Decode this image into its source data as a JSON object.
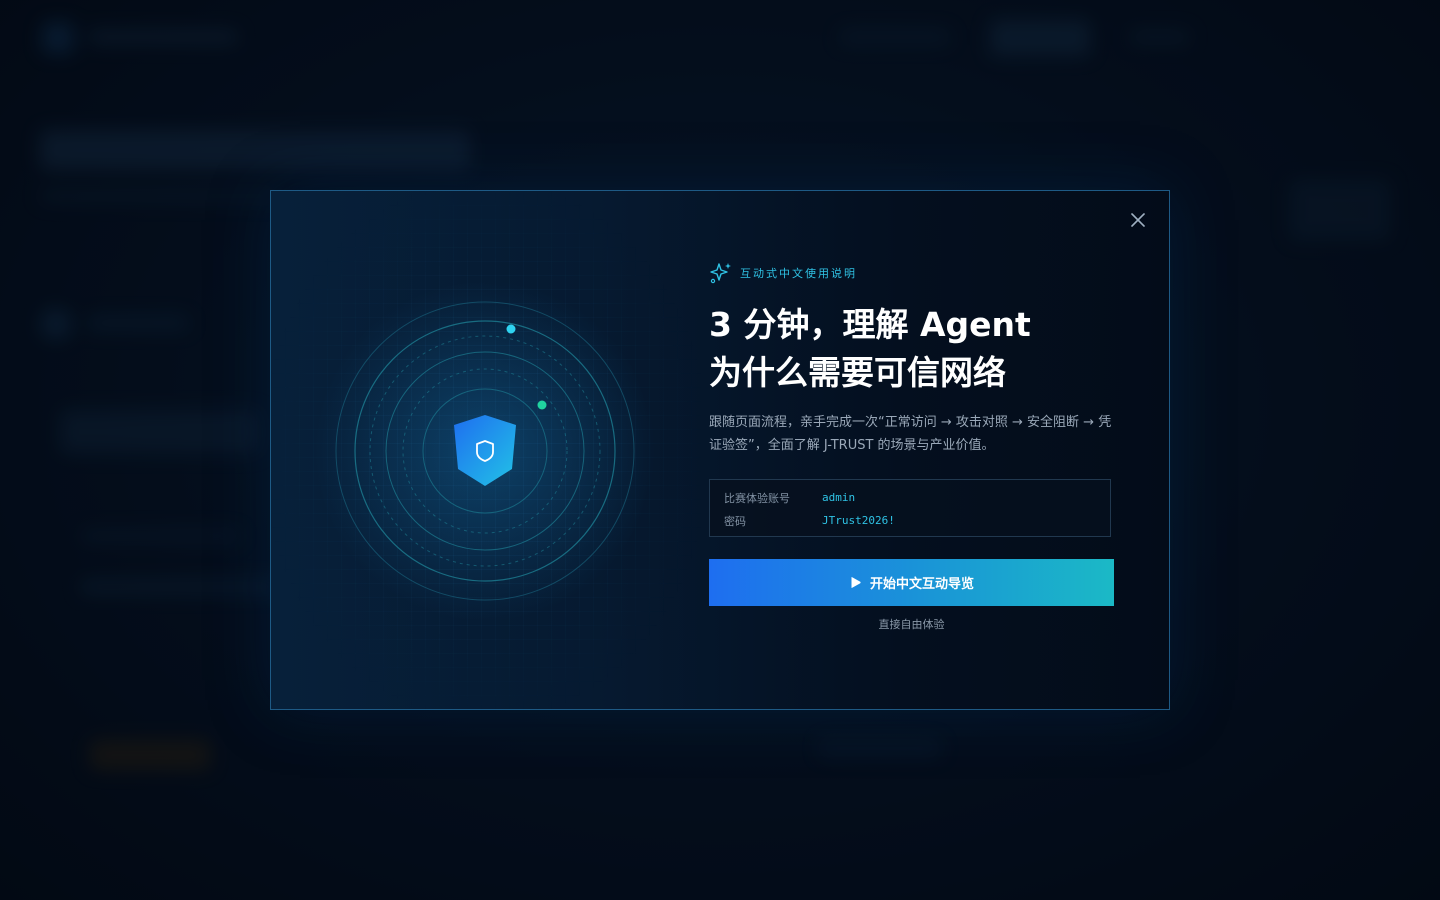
{
  "modal": {
    "kicker": "互动式中文使用说明",
    "title_line1": "3 分钟，理解 Agent",
    "title_line2": "为什么需要可信网络",
    "description": "跟随页面流程，亲手完成一次“正常访问 → 攻击对照 → 安全阻断 → 凭证验签”，全面了解 J-TRUST 的场景与产业价值。",
    "credentials": {
      "account_label": "比赛体验账号",
      "account_value": "admin",
      "password_label": "密码",
      "password_value": "JTrust2026!"
    },
    "start_button": "开始中文互动导览",
    "skip_link": "直接自由体验"
  },
  "icons": {
    "close": "close-icon",
    "sparkle": "sparkle-icon",
    "shield": "shield-icon",
    "play": "play-icon"
  },
  "colors": {
    "accent_cyan": "#2fc2e4",
    "button_gradient_start": "#1e6ef0",
    "button_gradient_end": "#1bb9c6",
    "shield_blue": "#1e88e5",
    "node_green": "#20d3a0"
  }
}
